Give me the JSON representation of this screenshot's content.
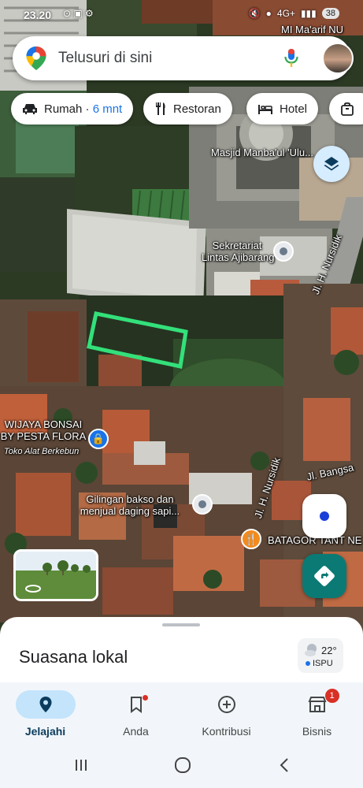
{
  "status_bar": {
    "time": "23.20",
    "left_icons": "⊙ ▣ ⚙",
    "network": "4G+",
    "battery": "38"
  },
  "search": {
    "placeholder": "Telusuri di sini",
    "icons": [
      "maps-pin-logo",
      "mic-icon",
      "avatar"
    ]
  },
  "chips": [
    {
      "icon": "car-icon",
      "label": "Rumah · ",
      "accent": "6 mnt"
    },
    {
      "icon": "fork-knife-icon",
      "label": "Restoran"
    },
    {
      "icon": "bed-icon",
      "label": "Hotel"
    },
    {
      "icon": "bag-icon",
      "label": ""
    }
  ],
  "map": {
    "labels": {
      "school": "MI Ma'arif NU",
      "mosque": "Masjid Manba'ul 'Ulu...",
      "secretariat_line1": "Sekretariat",
      "secretariat_line2": "Lintas Ajibarang",
      "road_1": "Jl. H. Nursidik",
      "road_2": "Jl. H. Nursidik",
      "road_3": "Jl. Bangsa",
      "bonsai_line1": "WIJAYA BONSAI",
      "bonsai_line2": "BY PESTA FLORA",
      "bonsai_sub": "Toko Alat Berkebun",
      "bakso_line1": "Gilingan bakso dan",
      "bakso_line2": "menjual daging sapi...",
      "batagor": "BATAGOR TANT NE"
    },
    "colors": {
      "highlight": "#33e07a",
      "road": "#9b9c98",
      "accent_blue": "#1a73e8",
      "food_orange": "#f28b1e"
    }
  },
  "sheet": {
    "title": "Suasana lokal",
    "weather_temp": "22°",
    "weather_aqi": "ISPU"
  },
  "nav": {
    "items": [
      {
        "label": "Jelajahi",
        "icon": "location-pin-icon",
        "active": true
      },
      {
        "label": "Anda",
        "icon": "bookmark-icon"
      },
      {
        "label": "Kontribusi",
        "icon": "plus-circle-icon"
      },
      {
        "label": "Bisnis",
        "icon": "storefront-icon",
        "badge": "1"
      }
    ]
  }
}
